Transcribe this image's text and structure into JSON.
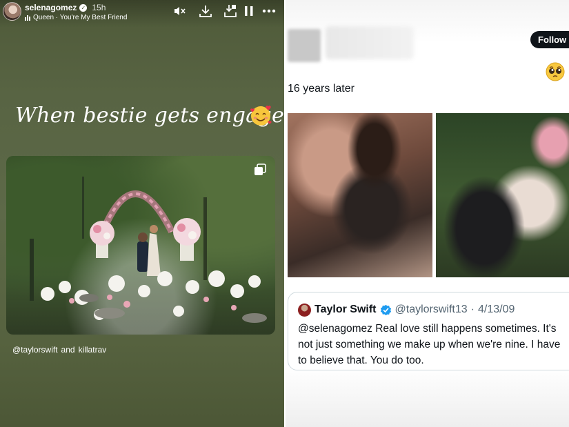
{
  "story": {
    "username": "selenagomez",
    "time_ago": "15h",
    "song": "Queen · You're My Best Friend",
    "caption": "When bestie gets engaged",
    "mentions": [
      "@taylorswift",
      "and",
      "killatrav"
    ],
    "icons": [
      "mute-icon",
      "download-icon",
      "save-icon",
      "pause-icon",
      "more-icon",
      "stack-icon",
      "smiling-hearts-emoji"
    ]
  },
  "tweet": {
    "follow_label": "Follow",
    "text": "16 years later",
    "emoji": "pleading-face-emoji",
    "quote": {
      "name": "Taylor Swift",
      "handle": "@taylorswift13",
      "separator": "·",
      "date": "4/13/09",
      "body": "@selenagomez Real love still happens sometimes. It's\nnot just something we make up when we're nine. I have\nto believe that. You do too."
    }
  },
  "colors": {
    "story_bg": "#596543",
    "follow_bg": "#0f1419",
    "verified_blue": "#1d9bf0",
    "text_dark": "#0f1419",
    "text_muted": "#536471"
  }
}
